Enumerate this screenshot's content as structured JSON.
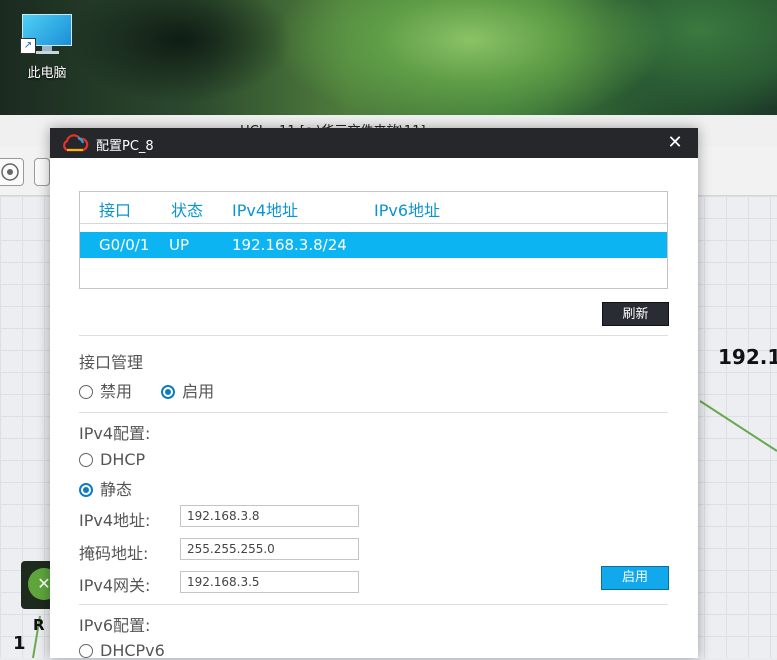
{
  "desktop": {
    "icon_label": "此电脑"
  },
  "background_app": {
    "title": "HCL - 11 [e:\\华三文件夹放\\11]",
    "ip_label": "192.1",
    "router_label": "R",
    "corner_number": "1"
  },
  "dialog": {
    "title": "配置PC_8",
    "close_symbol": "✕",
    "table": {
      "headers": [
        "接口",
        "状态",
        "IPv4地址",
        "IPv6地址"
      ],
      "rows": [
        {
          "interface": "G0/0/1",
          "status": "UP",
          "ipv4": "192.168.3.8/24",
          "ipv6": ""
        }
      ]
    },
    "refresh_label": "刷新",
    "interface_mgmt": {
      "title": "接口管理",
      "options": [
        "禁用",
        "启用"
      ],
      "selected": "启用"
    },
    "ipv4": {
      "title": "IPv4配置:",
      "options": [
        "DHCP",
        "静态"
      ],
      "selected": "静态",
      "address_label": "IPv4地址:",
      "address_value": "192.168.3.8",
      "mask_label": "掩码地址:",
      "mask_value": "255.255.255.0",
      "gateway_label": "IPv4网关:",
      "gateway_value": "192.168.3.5",
      "apply_label": "启用"
    },
    "ipv6": {
      "title": "IPv6配置:",
      "options": [
        "DHCPv6"
      ]
    }
  },
  "colors": {
    "accent_blue": "#0cb4f2",
    "titlebar": "#26272b",
    "header_text": "#0b94cf",
    "link_green": "#6aa84f"
  },
  "icons": {
    "desktop_icon": "computer-monitor-icon",
    "dialog_icon": "cloud-icon",
    "close": "close-icon",
    "router": "router-icon"
  }
}
